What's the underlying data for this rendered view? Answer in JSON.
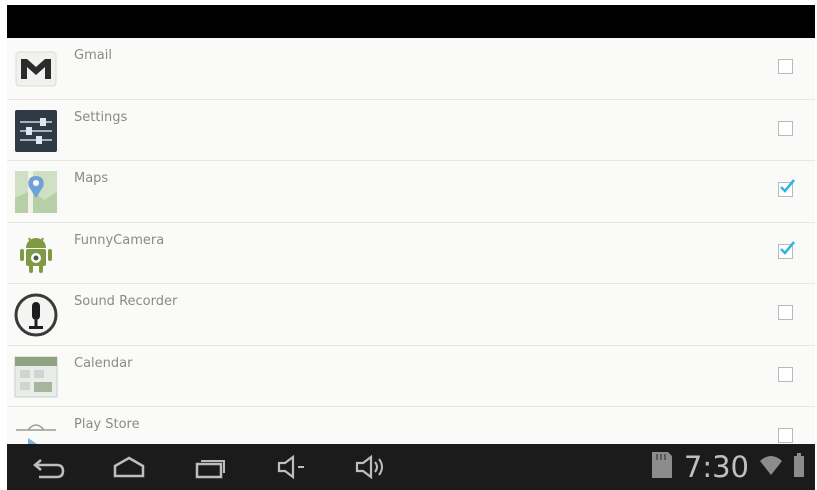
{
  "apps": [
    {
      "label": "Gmail",
      "icon": "gmail-icon",
      "checked": false
    },
    {
      "label": "Settings",
      "icon": "settings-icon",
      "checked": false
    },
    {
      "label": "Maps",
      "icon": "maps-icon",
      "checked": true
    },
    {
      "label": "FunnyCamera",
      "icon": "android-robot-icon",
      "checked": true
    },
    {
      "label": "Sound Recorder",
      "icon": "microphone-icon",
      "checked": false
    },
    {
      "label": "Calendar",
      "icon": "calendar-icon",
      "checked": false
    },
    {
      "label": "Play Store",
      "icon": "play-store-icon",
      "checked": false
    }
  ],
  "nav_bar": {
    "buttons": [
      "back-icon",
      "home-icon",
      "recent-apps-icon",
      "volume-down-icon",
      "volume-up-icon"
    ],
    "status_icons": [
      "sd-card-icon",
      "wifi-icon",
      "battery-icon"
    ],
    "clock": "7:30"
  },
  "colors": {
    "check_accent": "#33b5e5",
    "nav_background": "#1b1b1b",
    "top_bar": "#000000"
  }
}
